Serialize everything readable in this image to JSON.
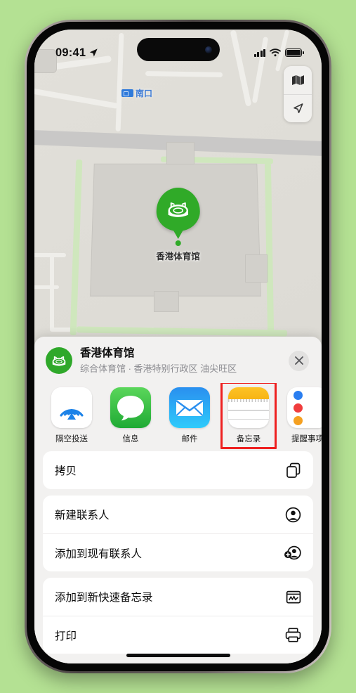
{
  "background_color": "#b4e193",
  "status_bar": {
    "time": "09:41",
    "location_arrow": "location-arrow-icon",
    "signal": "cellular-signal-icon",
    "wifi": "wifi-icon",
    "battery": "battery-icon"
  },
  "map": {
    "label_nankou": "南口",
    "pin_label": "香港体育馆",
    "controls": [
      {
        "name": "map-type-button",
        "icon": "folded-map-icon"
      },
      {
        "name": "locate-me-button",
        "icon": "navigation-arrow-icon"
      }
    ]
  },
  "share_sheet": {
    "title": "香港体育馆",
    "subtitle": "综合体育馆 · 香港特别行政区 油尖旺区",
    "close_label": "✕",
    "apps": [
      {
        "label": "隔空投送",
        "icon": "airdrop-icon",
        "highlighted": false
      },
      {
        "label": "信息",
        "icon": "messages-icon",
        "highlighted": false
      },
      {
        "label": "邮件",
        "icon": "mail-icon",
        "highlighted": false
      },
      {
        "label": "备忘录",
        "icon": "notes-icon",
        "highlighted": true
      },
      {
        "label": "提醒事项",
        "icon": "reminders-icon",
        "highlighted": false
      }
    ],
    "actions": [
      {
        "label": "拷贝",
        "icon": "copy-icon"
      },
      {
        "label": "新建联系人",
        "icon": "new-contact-icon"
      },
      {
        "label": "添加到现有联系人",
        "icon": "add-to-contact-icon"
      },
      {
        "label": "添加到新快速备忘录",
        "icon": "quick-note-icon"
      },
      {
        "label": "打印",
        "icon": "printer-icon"
      }
    ]
  },
  "highlight": {
    "color": "#ee2020",
    "target": "备忘录"
  }
}
